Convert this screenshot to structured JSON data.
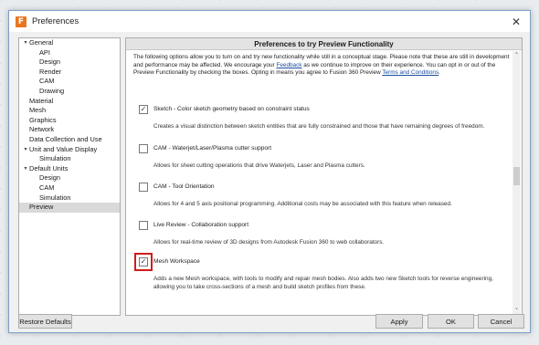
{
  "window": {
    "title": "Preferences",
    "icon_glyph": "F",
    "close_glyph": "✕"
  },
  "tree": [
    {
      "label": "General",
      "indent": 0,
      "expander": "▾"
    },
    {
      "label": "API",
      "indent": 2
    },
    {
      "label": "Design",
      "indent": 2
    },
    {
      "label": "Render",
      "indent": 2
    },
    {
      "label": "CAM",
      "indent": 2
    },
    {
      "label": "Drawing",
      "indent": 2
    },
    {
      "label": "Material",
      "indent": 1
    },
    {
      "label": "Mesh",
      "indent": 1
    },
    {
      "label": "Graphics",
      "indent": 1
    },
    {
      "label": "Network",
      "indent": 1
    },
    {
      "label": "Data Collection and Use",
      "indent": 1
    },
    {
      "label": "Unit and Value Display",
      "indent": 0,
      "expander": "▾"
    },
    {
      "label": "Simulation",
      "indent": 2
    },
    {
      "label": "Default Units",
      "indent": 0,
      "expander": "▾"
    },
    {
      "label": "Design",
      "indent": 2
    },
    {
      "label": "CAM",
      "indent": 2
    },
    {
      "label": "Simulation",
      "indent": 2
    },
    {
      "label": "Preview",
      "indent": 1,
      "selected": true
    }
  ],
  "pane": {
    "header": "Preferences to try Preview Functionality",
    "intro_part1": "The following options allow you to turn on and try new functionality while still in a conceptual stage. Please note that these are still in development and performance may be affected. We encourage your ",
    "intro_feedback": "Feedback",
    "intro_part2": " as we continue to improve on their experience. You can opt in or out of the Preview Functionality by checking the boxes. Opting in means you agree to Fusion 360 Preview ",
    "intro_terms": "Terms and Conditions",
    "intro_end": "."
  },
  "features": [
    {
      "title": "Sketch - Color sketch geometry based on constraint status",
      "desc": "Creates a visual distinction between sketch entities that are fully constrained and those that have remaining degrees of freedom.",
      "checked": true,
      "highlighted": false
    },
    {
      "title": "CAM - Waterjet/Laser/Plasma cutter support",
      "desc": "Allows for sheet cutting operations that drive Waterjets, Laser and Plasma cutters.",
      "checked": false,
      "highlighted": false
    },
    {
      "title": "CAM - Tool Orientation",
      "desc": "Allows for 4 and 5 axis positional programming. Additional costs may be associated with this feature when released.",
      "checked": false,
      "highlighted": false
    },
    {
      "title": "Live Review - Collaboration support",
      "desc": "Allows for real-time review of 3D designs from Autodesk Fusion 360 to web collaborators.",
      "checked": false,
      "highlighted": false
    },
    {
      "title": "Mesh Workspace",
      "desc": "Adds a new Mesh workspace, with tools to modify and repair mesh bodies. Also adds two new Sketch tools for reverse engineering, allowing you to take cross-sections of a mesh and build sketch profiles from these.",
      "checked": true,
      "highlighted": true
    }
  ],
  "checkmark_glyph": "✓",
  "scroll": {
    "up_glyph": "˄",
    "down_glyph": "˅"
  },
  "buttons": {
    "restore": "Restore Defaults",
    "apply": "Apply",
    "ok": "OK",
    "cancel": "Cancel"
  },
  "colors": {
    "highlight": "#d01c1c",
    "link": "#1a4fa0",
    "accent": "#e87722"
  }
}
